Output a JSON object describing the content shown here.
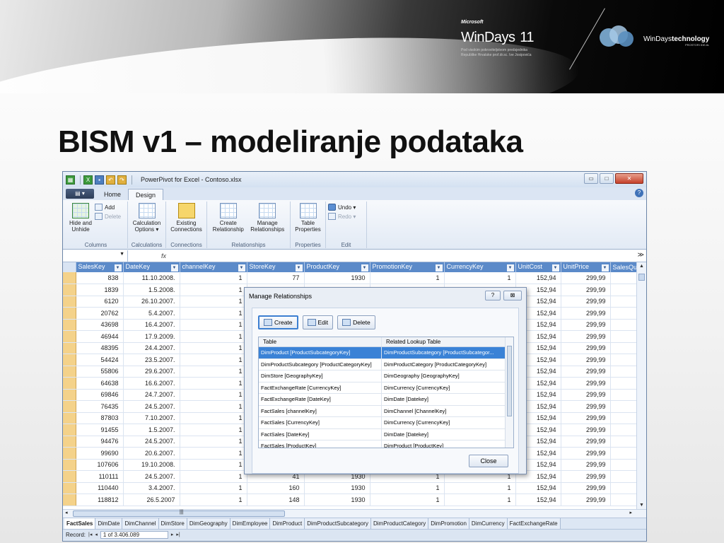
{
  "slide": {
    "title": "BISM v1 – modeliranje podataka"
  },
  "banner": {
    "microsoft": "Microsoft",
    "windays_name": "WinDays",
    "windays_number": "11",
    "windays_sub1": "Pod visokim pokroviteljstvom predsjednika",
    "windays_sub2": "Republike Hrvatske prof.dr.sc. Ive Josipovića",
    "tech_prefix": "WinDays",
    "tech_suffix": "technology",
    "tech_sub": "PROSTORI IDEJA."
  },
  "window": {
    "title": "PowerPivot for Excel - Contoso.xlsx",
    "controls": [
      "▭",
      "□",
      "✕"
    ],
    "tabs": [
      "Home",
      "Design"
    ],
    "active_tab": "Design",
    "file_tab": "▤ ▾"
  },
  "ribbon": {
    "groups": [
      {
        "label": "Columns",
        "big": "Hide and Unhide",
        "small": [
          "Add",
          "Delete"
        ]
      },
      {
        "label": "Calculations",
        "big": "Calculation Options ▾"
      },
      {
        "label": "Connections",
        "big": "Existing Connections"
      },
      {
        "label": "Relationships",
        "big1": "Create Relationship",
        "big2": "Manage Relationships"
      },
      {
        "label": "Properties",
        "big": "Table Properties"
      },
      {
        "label": "Edit",
        "small": [
          "Undo ▾",
          "Redo ▾"
        ]
      }
    ]
  },
  "formula_bar": {
    "fx": "fx",
    "expand": "≫"
  },
  "grid": {
    "columns": [
      "SalesKey",
      "DateKey",
      "channelKey",
      "StoreKey",
      "ProductKey",
      "PromotionKey",
      "CurrencyKey",
      "UnitCost",
      "UnitPrice",
      "SalesQu"
    ],
    "rows": [
      [
        "838",
        "11.10.2008.",
        "1",
        "77",
        "1930",
        "1",
        "1",
        "152,94",
        "299,99"
      ],
      [
        "1839",
        "1.5.2008.",
        "1",
        "",
        "",
        "",
        "",
        "152,94",
        "299,99"
      ],
      [
        "6120",
        "26.10.2007.",
        "1",
        "",
        "",
        "",
        "",
        "152,94",
        "299,99"
      ],
      [
        "20762",
        "5.4.2007.",
        "1",
        "",
        "",
        "",
        "",
        "152,94",
        "299,99"
      ],
      [
        "43698",
        "16.4.2007.",
        "1",
        "",
        "",
        "",
        "",
        "152,94",
        "299,99"
      ],
      [
        "46944",
        "17.9.2009.",
        "1",
        "",
        "",
        "",
        "",
        "152,94",
        "299,99"
      ],
      [
        "48395",
        "24.4.2007.",
        "1",
        "",
        "",
        "",
        "",
        "152,94",
        "299,99"
      ],
      [
        "54424",
        "23.5.2007.",
        "1",
        "",
        "",
        "",
        "",
        "152,94",
        "299,99"
      ],
      [
        "55806",
        "29.6.2007.",
        "1",
        "",
        "",
        "",
        "",
        "152,94",
        "299,99"
      ],
      [
        "64638",
        "16.6.2007.",
        "1",
        "",
        "",
        "",
        "",
        "152,94",
        "299,99"
      ],
      [
        "69846",
        "24.7.2007.",
        "1",
        "",
        "",
        "",
        "",
        "152,94",
        "299,99"
      ],
      [
        "76435",
        "24.5.2007.",
        "1",
        "",
        "",
        "",
        "",
        "152,94",
        "299,99"
      ],
      [
        "87803",
        "7.10.2007.",
        "1",
        "",
        "",
        "",
        "",
        "152,94",
        "299,99"
      ],
      [
        "91455",
        "1.5.2007.",
        "1",
        "",
        "",
        "",
        "",
        "152,94",
        "299,99"
      ],
      [
        "94476",
        "24.5.2007.",
        "1",
        "",
        "",
        "",
        "",
        "152,94",
        "299,99"
      ],
      [
        "99690",
        "20.6.2007.",
        "1",
        "",
        "",
        "",
        "",
        "152,94",
        "299,99"
      ],
      [
        "107606",
        "19.10.2008.",
        "1",
        "",
        "",
        "",
        "",
        "152,94",
        "299,99"
      ],
      [
        "110111",
        "24.5.2007.",
        "1",
        "41",
        "1930",
        "1",
        "1",
        "152,94",
        "299,99"
      ],
      [
        "110440",
        "3.4.2007.",
        "1",
        "160",
        "1930",
        "1",
        "1",
        "152,94",
        "299,99"
      ],
      [
        "118812",
        "26.5.2007",
        "1",
        "148",
        "1930",
        "1",
        "1",
        "152,94",
        "299,99"
      ]
    ]
  },
  "sheet_tabs": [
    "FactSales",
    "DimDate",
    "DimChannel",
    "DimStore",
    "DimGeography",
    "DimEmployee",
    "DimProduct",
    "DimProductSubcategory",
    "DimProductCategory",
    "DimPromotion",
    "DimCurrency",
    "FactExchangeRate"
  ],
  "active_sheet": "FactSales",
  "status": {
    "label": "Record:",
    "first": "|◂",
    "prev": "◂",
    "record": "1 of 3.406.089",
    "next": "▸",
    "last": "▸|"
  },
  "dialog": {
    "title": "Manage Relationships",
    "help": "?",
    "close_x": "⊠",
    "buttons": [
      "Create",
      "Edit",
      "Delete"
    ],
    "headers": [
      "Table",
      "Related Lookup Table"
    ],
    "rows": [
      [
        "DimProduct [ProductSubcategoryKey]",
        "DimProductSubcategory [ProductSubcategor..."
      ],
      [
        "DimProductSubcategory [ProductCategoryKey]",
        "DimProductCategory [ProductCategoryKey]"
      ],
      [
        "DimStore [GeographyKey]",
        "DimGeography [GeographyKey]"
      ],
      [
        "FactExchangeRate [CurrencyKey]",
        "DimCurrency [CurrencyKey]"
      ],
      [
        "FactExchangeRate [DateKey]",
        "DimDate [Datekey]"
      ],
      [
        "FactSales [channelKey]",
        "DimChannel [ChannelKey]"
      ],
      [
        "FactSales [CurrencyKey]",
        "DimCurrency [CurrencyKey]"
      ],
      [
        "FactSales [DateKey]",
        "DimDate [Datekey]"
      ],
      [
        "FactSales [ProductKey]",
        "DimProduct [ProductKey]"
      ]
    ],
    "close_label": "Close"
  }
}
